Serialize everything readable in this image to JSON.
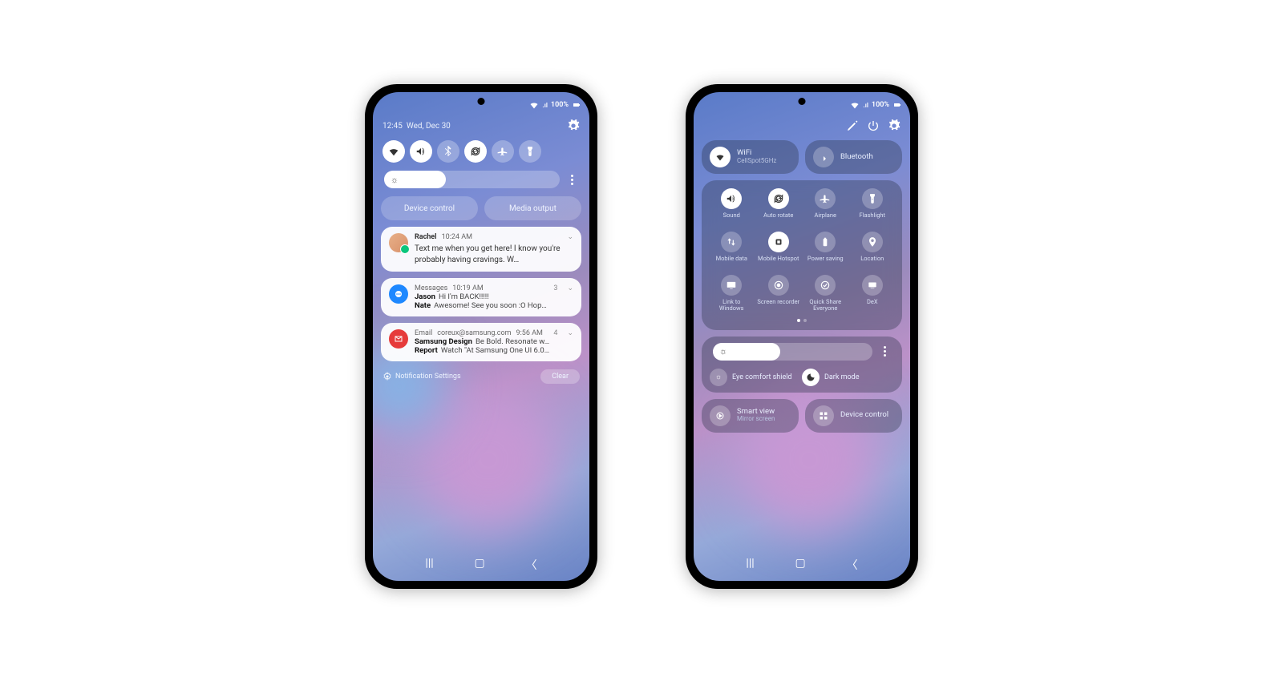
{
  "status_bar": {
    "battery_text": "100%",
    "signal": "wifi-5g"
  },
  "left": {
    "time": "12:45",
    "date": "Wed, Dec 30",
    "quick_toggles": [
      {
        "name": "wifi",
        "on": true
      },
      {
        "name": "sound",
        "on": true
      },
      {
        "name": "bluetooth",
        "on": false
      },
      {
        "name": "auto-rotate",
        "on": true
      },
      {
        "name": "airplane",
        "on": false
      },
      {
        "name": "flashlight",
        "on": false
      }
    ],
    "brightness_pct": 35,
    "pills": {
      "device_control": "Device control",
      "media_output": "Media output"
    },
    "notifications": [
      {
        "kind": "chat",
        "sender": "Rachel",
        "time": "10:24 AM",
        "body": "Text me when you get here! I know you're probably having cravings. W…"
      },
      {
        "kind": "messages",
        "app": "Messages",
        "time": "10:19 AM",
        "count": "3",
        "lines": [
          {
            "name": "Jason",
            "text": "Hi I'm BACK!!!!!"
          },
          {
            "name": "Nate",
            "text": "Awesome! See you soon :O Hop…"
          }
        ]
      },
      {
        "kind": "email",
        "app": "Email",
        "address": "coreux@samsung.com",
        "time": "9:56 AM",
        "count": "4",
        "lines": [
          {
            "name": "Samsung Design",
            "text": "Be Bold. Resonate w…"
          },
          {
            "name": "Report",
            "text": "Watch \"At Samsung One UI 6.0…"
          }
        ]
      }
    ],
    "footer": {
      "settings": "Notification Settings",
      "clear": "Clear"
    }
  },
  "right": {
    "header_icons": [
      "edit",
      "power",
      "settings"
    ],
    "wifi": {
      "label": "WiFi",
      "sub": "CellSpot5GHz",
      "on": true
    },
    "bluetooth": {
      "label": "Bluetooth",
      "on": false
    },
    "grid": [
      {
        "name": "Sound",
        "on": true,
        "icon": "sound"
      },
      {
        "name": "Auto rotate",
        "on": true,
        "icon": "rotate"
      },
      {
        "name": "Airplane",
        "on": false,
        "icon": "airplane"
      },
      {
        "name": "Flashlight",
        "on": false,
        "icon": "flashlight"
      },
      {
        "name": "Mobile data",
        "on": false,
        "icon": "updown"
      },
      {
        "name": "Mobile Hotspot",
        "on": true,
        "icon": "hotspot"
      },
      {
        "name": "Power saving",
        "on": false,
        "icon": "battery"
      },
      {
        "name": "Location",
        "on": false,
        "icon": "location"
      },
      {
        "name": "Link to Windows",
        "on": false,
        "icon": "windows"
      },
      {
        "name": "Screen recorder",
        "on": false,
        "icon": "record"
      },
      {
        "name": "Quick Share Everyone",
        "on": false,
        "icon": "share"
      },
      {
        "name": "DeX",
        "on": false,
        "icon": "dex"
      }
    ],
    "brightness_pct": 42,
    "eye_comfort": "Eye comfort shield",
    "dark_mode": "Dark mode",
    "smart_view": {
      "label": "Smart view",
      "sub": "Mirror screen"
    },
    "device_control": "Device control"
  },
  "colors": {
    "active": "#ffffff",
    "inactive_bg": "rgba(255,255,255,.25)"
  }
}
